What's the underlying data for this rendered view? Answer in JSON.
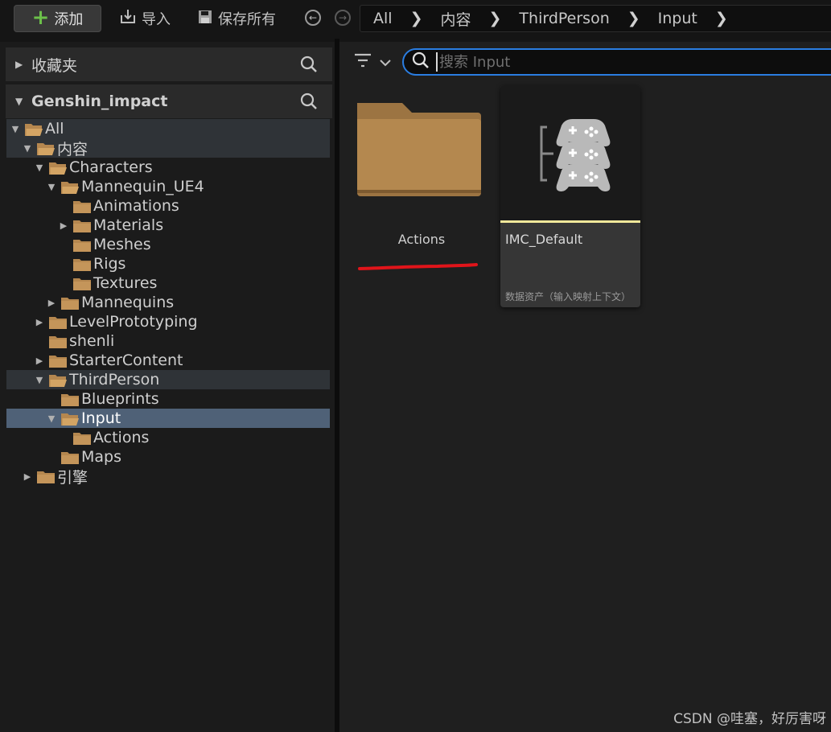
{
  "toolbar": {
    "add_label": "添加",
    "import_label": "导入",
    "save_all_label": "保存所有"
  },
  "breadcrumb": [
    "All",
    "内容",
    "ThirdPerson",
    "Input"
  ],
  "left_panel": {
    "favorites_label": "收藏夹",
    "project_label": "Genshin_impact",
    "tree": [
      {
        "label": "All",
        "depth": 0,
        "twisty": "open",
        "folder": "open",
        "state": "highlight"
      },
      {
        "label": "内容",
        "depth": 1,
        "twisty": "open",
        "folder": "open",
        "state": "highlight"
      },
      {
        "label": "Characters",
        "depth": 2,
        "twisty": "open",
        "folder": "open",
        "state": ""
      },
      {
        "label": "Mannequin_UE4",
        "depth": 3,
        "twisty": "open",
        "folder": "open",
        "state": ""
      },
      {
        "label": "Animations",
        "depth": 4,
        "twisty": "none",
        "folder": "closed",
        "state": ""
      },
      {
        "label": "Materials",
        "depth": 4,
        "twisty": "closed",
        "folder": "closed",
        "state": ""
      },
      {
        "label": "Meshes",
        "depth": 4,
        "twisty": "none",
        "folder": "closed",
        "state": ""
      },
      {
        "label": "Rigs",
        "depth": 4,
        "twisty": "none",
        "folder": "closed",
        "state": ""
      },
      {
        "label": "Textures",
        "depth": 4,
        "twisty": "none",
        "folder": "closed",
        "state": ""
      },
      {
        "label": "Mannequins",
        "depth": 3,
        "twisty": "closed",
        "folder": "closed",
        "state": ""
      },
      {
        "label": "LevelPrototyping",
        "depth": 2,
        "twisty": "closed",
        "folder": "closed",
        "state": ""
      },
      {
        "label": "shenli",
        "depth": 2,
        "twisty": "none",
        "folder": "closed",
        "state": ""
      },
      {
        "label": "StarterContent",
        "depth": 2,
        "twisty": "closed",
        "folder": "closed",
        "state": ""
      },
      {
        "label": "ThirdPerson",
        "depth": 2,
        "twisty": "open",
        "folder": "open",
        "state": "highlight"
      },
      {
        "label": "Blueprints",
        "depth": 3,
        "twisty": "none",
        "folder": "closed",
        "state": ""
      },
      {
        "label": "Input",
        "depth": 3,
        "twisty": "open",
        "folder": "open",
        "state": "selected"
      },
      {
        "label": "Actions",
        "depth": 4,
        "twisty": "none",
        "folder": "closed",
        "state": ""
      },
      {
        "label": "Maps",
        "depth": 3,
        "twisty": "none",
        "folder": "closed",
        "state": ""
      },
      {
        "label": "引擎",
        "depth": 1,
        "twisty": "closed",
        "folder": "closed",
        "state": ""
      }
    ]
  },
  "search": {
    "placeholder": "搜索 Input",
    "value": ""
  },
  "assets": {
    "folder_name": "Actions",
    "data_asset_name": "IMC_Default",
    "data_asset_type": "数据资产（输入映射上下文）"
  },
  "colors": {
    "accent": "#2a7de1",
    "folder": "#b5874f",
    "selection": "#4f6177",
    "asset_bar": "#f1e89a",
    "annotation": "#e0141a"
  },
  "watermark": "CSDN @哇塞，好厉害呀"
}
